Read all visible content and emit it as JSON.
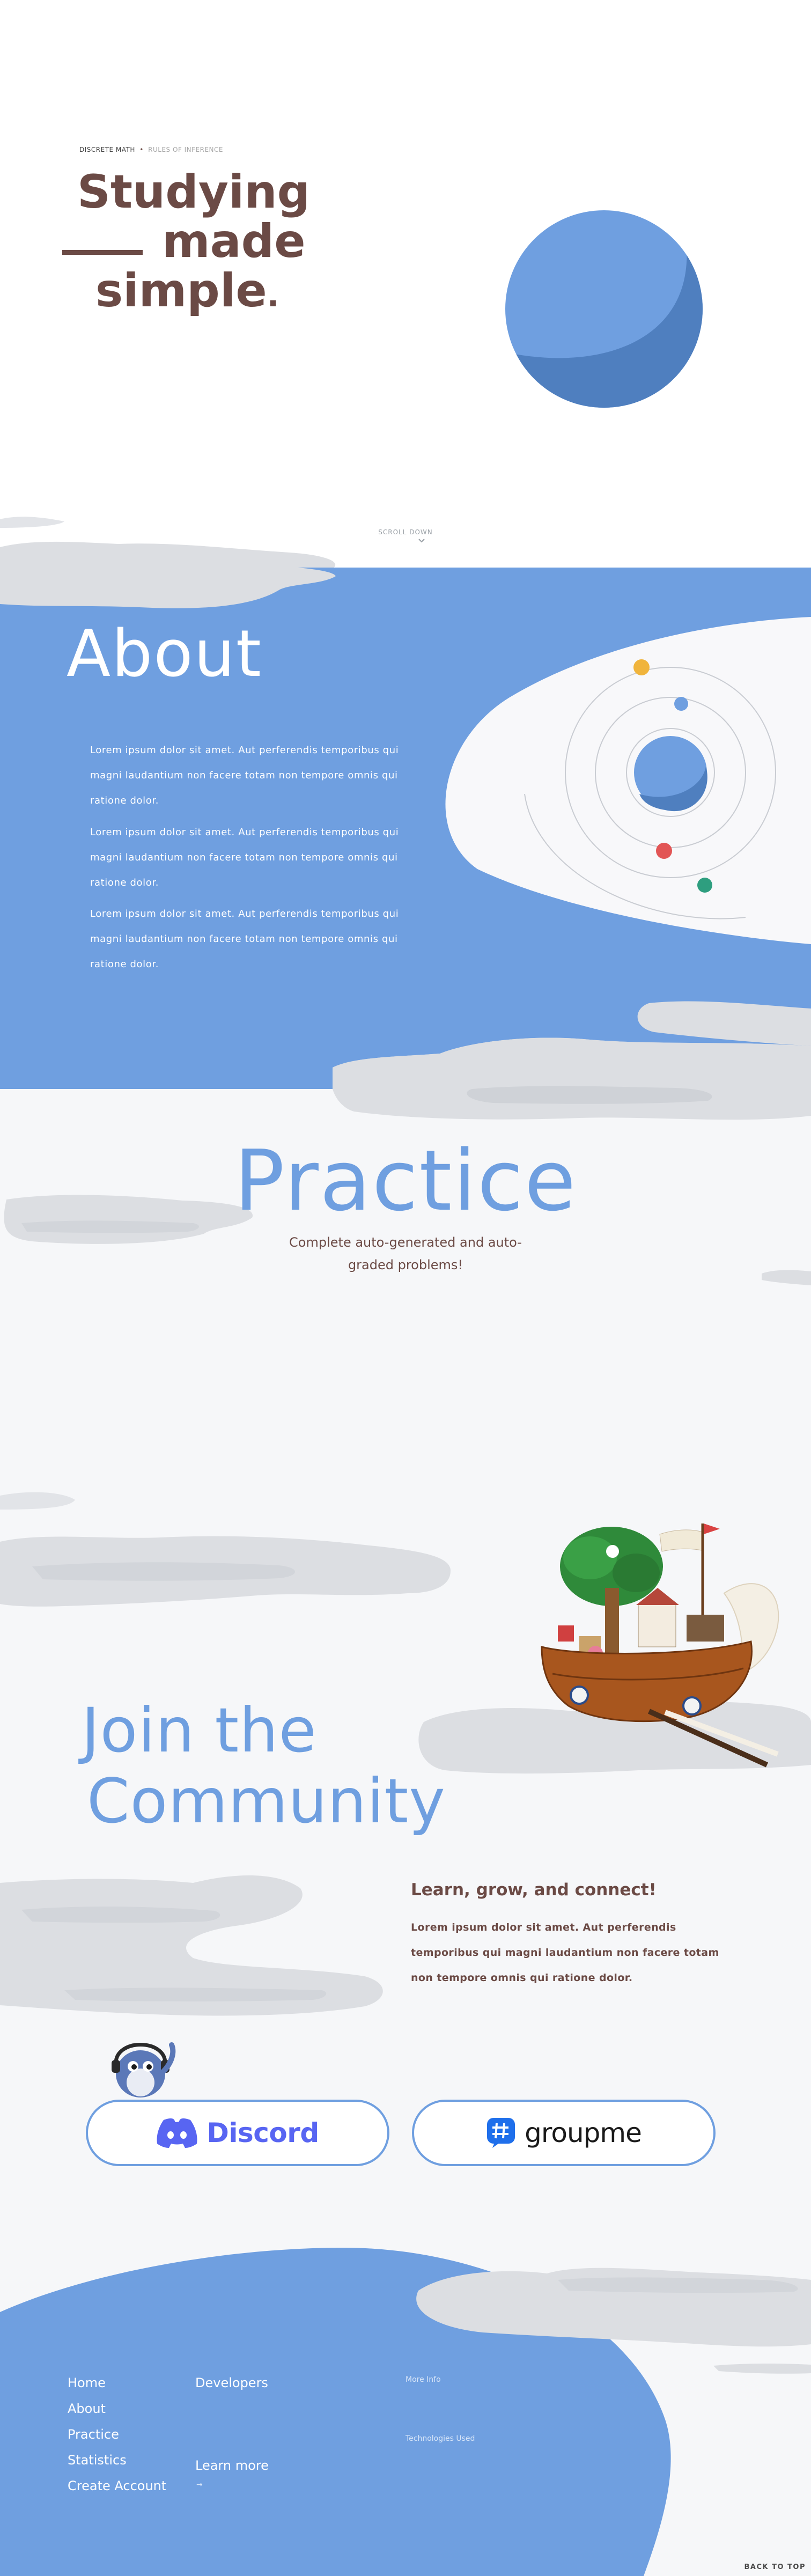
{
  "breadcrumb": {
    "section": "DISCRETE MATH",
    "separator": "•",
    "page": "RULES OF INFERENCE"
  },
  "hero": {
    "line1": "Studying",
    "line2": "made",
    "line3": "simple",
    "dot": "."
  },
  "scroll": {
    "label": "SCROLL DOWN"
  },
  "about": {
    "title": "About",
    "paragraphs": [
      "Lorem ipsum dolor sit amet. Aut perferendis temporibus qui magni laudantium non facere totam non tempore omnis qui ratione dolor.",
      "Lorem ipsum dolor sit amet. Aut perferendis temporibus qui magni laudantium non facere totam non tempore omnis qui ratione dolor.",
      "Lorem ipsum dolor sit amet. Aut perferendis temporibus qui magni laudantium non facere totam non tempore omnis qui ratione dolor."
    ]
  },
  "practice": {
    "title": "Practice",
    "subtitle": "Complete auto-generated and auto-graded problems!"
  },
  "community": {
    "title_line1": "Join the",
    "title_line2": "Community",
    "heading": "Learn, grow, and connect!",
    "body": "Lorem ipsum dolor sit amet. Aut perferendis temporibus qui magni laudantium non facere totam non tempore omnis qui ratione dolor.",
    "discord_label": "Discord",
    "groupme_label": "groupme"
  },
  "footer": {
    "nav": [
      "Home",
      "About",
      "Practice",
      "Statistics",
      "Create Account"
    ],
    "developers_label": "Developers",
    "learn_more_label": "Learn more",
    "learn_more_sub": "→",
    "small_1": "More Info",
    "small_2": "Technologies Used",
    "back_to_top": "BACK TO TOP"
  },
  "colors": {
    "brand_blue": "#6f9fe0",
    "brown": "#6b4a45",
    "planet_light": "#6f9fe0",
    "planet_dark": "#4f7fbf",
    "cloud": "#dcdee2",
    "discord": "#5865f2"
  }
}
